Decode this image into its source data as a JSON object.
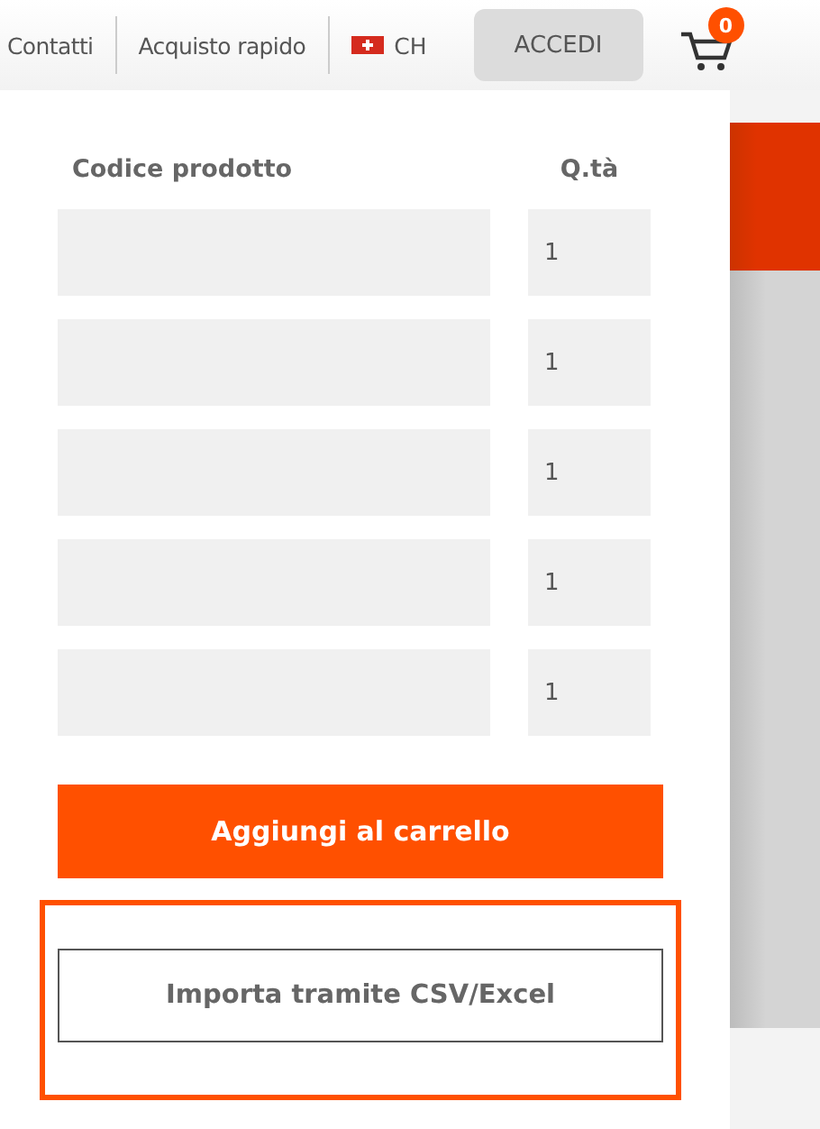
{
  "nav": {
    "links": [
      {
        "label": "Contatti"
      },
      {
        "label": "Acquisto rapido"
      }
    ],
    "locale": {
      "label": "CH"
    },
    "login_button": "ACCEDI",
    "cart": {
      "count": "0"
    }
  },
  "quick_order": {
    "columns": [
      "Codice prodotto",
      "Q.tà"
    ],
    "rows": [
      {
        "quantity": "1"
      },
      {
        "quantity": "1"
      },
      {
        "quantity": "1"
      },
      {
        "quantity": "1"
      },
      {
        "quantity": "1"
      }
    ],
    "add_button": "Aggiungi al carrello",
    "import_button": {
      "label": "Importa tramite CSV/Excel",
      "highlighted": true
    }
  }
}
